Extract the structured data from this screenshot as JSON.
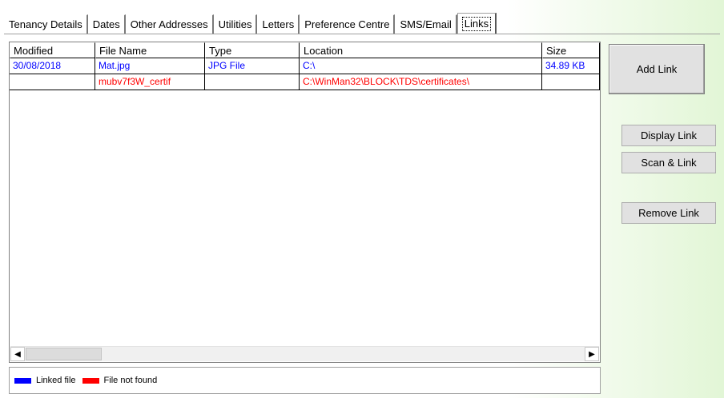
{
  "tabs": [
    {
      "label": "Tenancy Details"
    },
    {
      "label": "Dates"
    },
    {
      "label": "Other Addresses"
    },
    {
      "label": "Utilities"
    },
    {
      "label": "Letters"
    },
    {
      "label": "Preference Centre"
    },
    {
      "label": "SMS/Email"
    },
    {
      "label": "Links",
      "active": true
    }
  ],
  "grid": {
    "columns": [
      "Modified",
      "File Name",
      "Type",
      "Location",
      "Size"
    ],
    "rows": [
      {
        "modified": "30/08/2018",
        "file_name": "Mat.jpg",
        "type": "JPG File",
        "location": "C:\\",
        "size": "34.89 KB",
        "status": "linked"
      },
      {
        "modified": "",
        "file_name": "mubv7f3W_certif",
        "type": "",
        "location": "C:\\WinMan32\\BLOCK\\TDS\\certificates\\",
        "size": "",
        "status": "not_found"
      }
    ]
  },
  "legend": {
    "linked": {
      "label": "Linked file",
      "color": "#0000ff"
    },
    "not_found": {
      "label": "File not found",
      "color": "#ff0000"
    }
  },
  "buttons": {
    "add_link": "Add Link",
    "display_link": "Display Link",
    "scan_link": "Scan & Link",
    "remove_link": "Remove Link"
  },
  "colors": {
    "linked_text": "#0000ff",
    "not_found_text": "#ff0000"
  },
  "icons": {
    "scroll_left": "triangle-left",
    "scroll_right": "triangle-right"
  }
}
